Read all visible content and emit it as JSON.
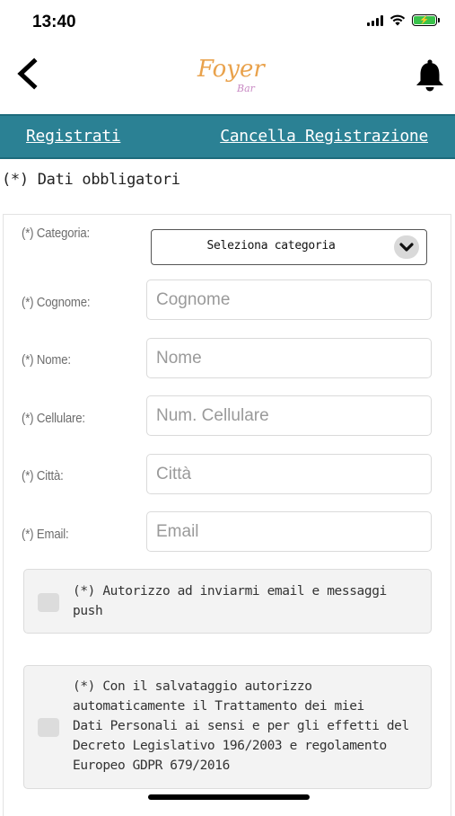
{
  "status_bar": {
    "time": "13:40"
  },
  "header": {
    "logo_main": "Foyer",
    "logo_sub": "Bar",
    "back_icon": "chevron-left-icon",
    "bell_icon": "bell-icon"
  },
  "nav": {
    "register_label": "Registrati",
    "unregister_label": "Cancella Registrazione",
    "color": "#2b8194"
  },
  "form": {
    "required_note": "(*) Dati obbligatori",
    "category": {
      "label": "(*) Categoria:",
      "selected": "Seleziona categoria"
    },
    "fields": {
      "surname": {
        "label": "(*) Cognome:",
        "placeholder": "Cognome"
      },
      "name": {
        "label": "(*) Nome:",
        "placeholder": "Nome"
      },
      "mobile": {
        "label": "(*) Cellulare:",
        "placeholder": "Num. Cellulare"
      },
      "city": {
        "label": "(*) Città:",
        "placeholder": "Città"
      },
      "email": {
        "label": "(*) Email:",
        "placeholder": "Email"
      }
    },
    "consent_marketing": {
      "line1": "(*) Autorizzo ad inviarmi email e messaggi",
      "line2": "push",
      "checked": false
    },
    "consent_privacy": {
      "line1": "(*) Con il salvataggio autorizzo",
      "line2": "automaticamente il Trattamento dei miei",
      "line3": "Dati Personali ai sensi e per gli effetti del",
      "line4": "Decreto Legislativo 196/2003 e regolamento",
      "line5": "Europeo GDPR 679/2016",
      "checked": false
    }
  }
}
